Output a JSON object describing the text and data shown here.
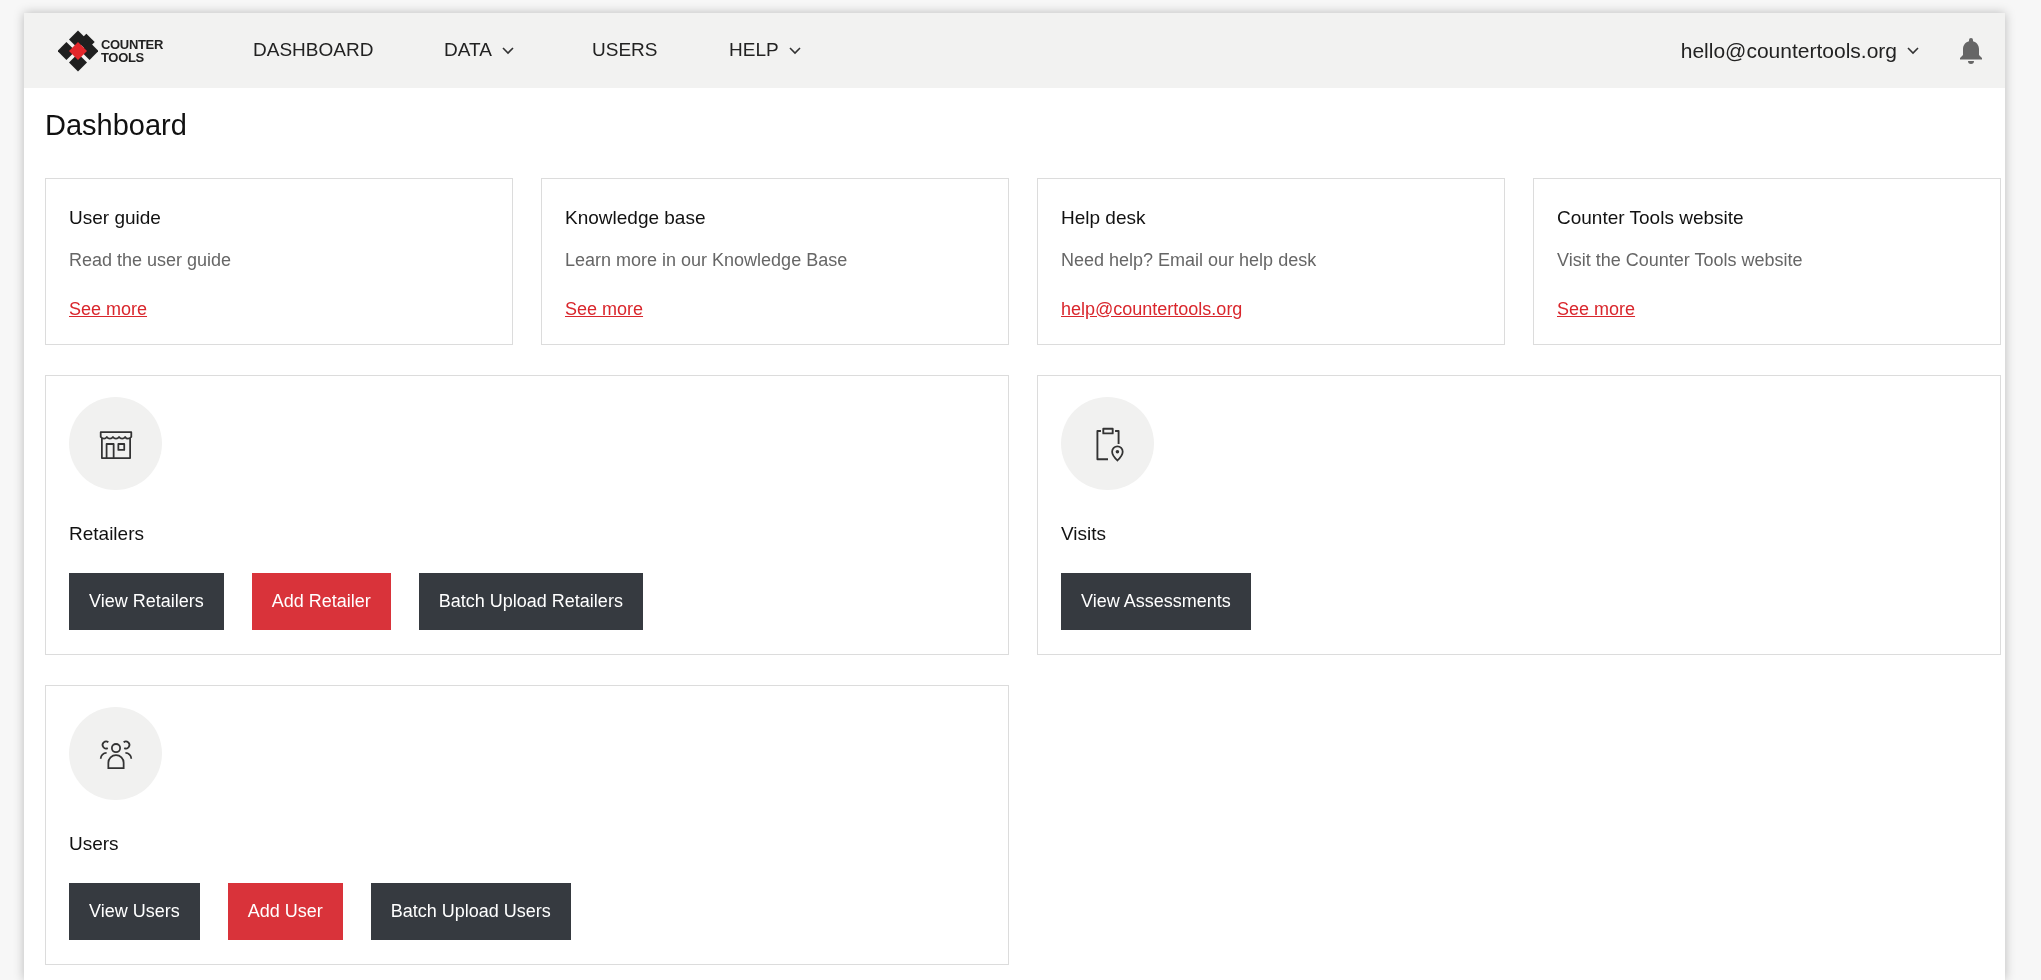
{
  "nav": {
    "logo": {
      "line_1": "COUNTER",
      "line_2": "TOOLS"
    },
    "items": [
      {
        "label": "DASHBOARD",
        "dropdown": false
      },
      {
        "label": "DATA",
        "dropdown": true
      },
      {
        "label": "USERS",
        "dropdown": false
      },
      {
        "label": "HELP",
        "dropdown": true
      }
    ],
    "account": "hello@countertools.org"
  },
  "page_title": "Dashboard",
  "info_cards": [
    {
      "title": "User guide",
      "text": "Read the user guide",
      "link": "See more"
    },
    {
      "title": "Knowledge base",
      "text": "Learn more in our Knowledge Base",
      "link": "See more"
    },
    {
      "title": "Help desk",
      "text": "Need help? Email our help desk",
      "link": "help@countertools.org"
    },
    {
      "title": "Counter Tools website",
      "text": "Visit the Counter Tools website",
      "link": "See more"
    }
  ],
  "sections": [
    {
      "kind": "store",
      "title": "Retailers",
      "buttons": [
        {
          "label": "View Retailers",
          "kind": "secondary"
        },
        {
          "label": "Add Retailer",
          "kind": "primary"
        },
        {
          "label": "Batch Upload Retailers",
          "kind": "secondary"
        }
      ]
    },
    {
      "kind": "clipboard",
      "title": "Visits",
      "buttons": [
        {
          "label": "View Assessments",
          "kind": "secondary"
        }
      ]
    },
    {
      "kind": "people",
      "title": "Users",
      "buttons": [
        {
          "label": "View Users",
          "kind": "secondary"
        },
        {
          "label": "Add User",
          "kind": "primary"
        },
        {
          "label": "Batch Upload Users",
          "kind": "secondary"
        }
      ]
    }
  ]
}
